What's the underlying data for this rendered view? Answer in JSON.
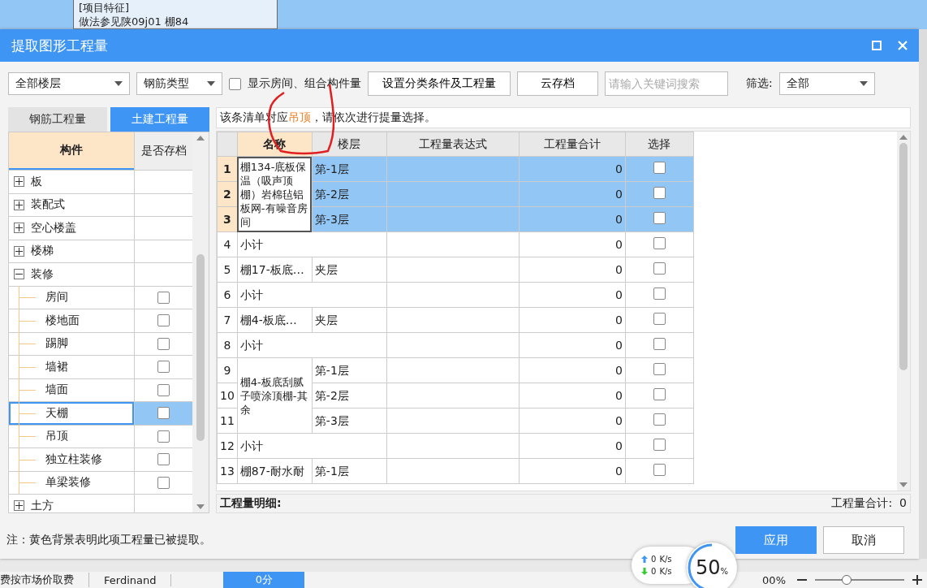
{
  "background_app": {
    "cell_lines": [
      "[项目特征]",
      "做法参见陕09j01 棚84"
    ]
  },
  "dialog": {
    "title": "提取图形工程量"
  },
  "toolbar": {
    "floor_dropdown": "全部楼层",
    "rebar_dropdown": "钢筋类型",
    "show_rooms": {
      "label": "显示房间、组合构件量",
      "checked": false
    },
    "buttons": [
      "设置分类条件及工程量",
      "云存档"
    ],
    "search": {
      "placeholder": "请输入关键词搜索"
    },
    "filter": {
      "label": "筛选:",
      "value": "全部"
    }
  },
  "left_tabs": [
    {
      "label": "钢筋工程量",
      "selected": false
    },
    {
      "label": "土建工程量",
      "selected": true
    }
  ],
  "component_tree": {
    "columns": [
      "构件",
      "是否存档"
    ],
    "items": [
      {
        "label": "板",
        "expanded": false
      },
      {
        "label": "装配式",
        "expanded": false
      },
      {
        "label": "空心楼盖",
        "expanded": false
      },
      {
        "label": "楼梯",
        "expanded": false
      },
      {
        "label": "装修",
        "expanded": true,
        "children": [
          {
            "label": "房间",
            "checked": false,
            "selected": false
          },
          {
            "label": "楼地面",
            "checked": false,
            "selected": false
          },
          {
            "label": "踢脚",
            "checked": false,
            "selected": false
          },
          {
            "label": "墙裙",
            "checked": false,
            "selected": false
          },
          {
            "label": "墙面",
            "checked": false,
            "selected": false
          },
          {
            "label": "天棚",
            "checked": false,
            "selected": true
          },
          {
            "label": "吊顶",
            "checked": false,
            "selected": false
          },
          {
            "label": "独立柱装修",
            "checked": false,
            "selected": false
          },
          {
            "label": "单梁装修",
            "checked": false,
            "selected": false
          }
        ]
      },
      {
        "label": "土方",
        "expanded": false
      }
    ]
  },
  "notice": {
    "before": "该条清单对应",
    "highlight": "吊顶",
    "after": "，请依次进行提量选择。"
  },
  "table": {
    "columns": [
      "名称",
      "楼层",
      "工程量表达式",
      "工程量合计",
      "选择"
    ],
    "groups": [
      {
        "kind": "item",
        "name": "棚134-底板保温（吸声顶棚）岩棉毡铝板网-有噪音房间",
        "focused": true,
        "rows": [
          {
            "no": "1",
            "floor": "第-1层",
            "total": "0",
            "checked": false,
            "selected": true
          },
          {
            "no": "2",
            "floor": "第-2层",
            "total": "0",
            "checked": false,
            "selected": true
          },
          {
            "no": "3",
            "floor": "第-3层",
            "total": "0",
            "checked": false,
            "selected": true
          }
        ]
      },
      {
        "kind": "subtotal",
        "name": "小计",
        "rows": [
          {
            "no": "4",
            "total": "0",
            "checked": false,
            "selected": false
          }
        ]
      },
      {
        "kind": "item",
        "name": "棚17-板底…",
        "focused": false,
        "rows": [
          {
            "no": "5",
            "floor": "夹层",
            "total": "0",
            "checked": false,
            "selected": false
          }
        ]
      },
      {
        "kind": "subtotal",
        "name": "小计",
        "rows": [
          {
            "no": "6",
            "total": "0",
            "checked": false,
            "selected": false
          }
        ]
      },
      {
        "kind": "item",
        "name": "棚4-板底…",
        "focused": false,
        "rows": [
          {
            "no": "7",
            "floor": "夹层",
            "total": "0",
            "checked": false,
            "selected": false
          }
        ]
      },
      {
        "kind": "subtotal",
        "name": "小计",
        "rows": [
          {
            "no": "8",
            "total": "0",
            "checked": false,
            "selected": false
          }
        ]
      },
      {
        "kind": "item",
        "name": "棚4-板底刮腻子喷涂顶棚-其余",
        "focused": false,
        "rows": [
          {
            "no": "9",
            "floor": "第-1层",
            "total": "0",
            "checked": false,
            "selected": false
          },
          {
            "no": "10",
            "floor": "第-2层",
            "total": "0",
            "checked": false,
            "selected": false
          },
          {
            "no": "11",
            "floor": "第-3层",
            "total": "0",
            "checked": false,
            "selected": false
          }
        ]
      },
      {
        "kind": "subtotal",
        "name": "小计",
        "rows": [
          {
            "no": "12",
            "total": "0",
            "checked": false,
            "selected": false
          }
        ]
      },
      {
        "kind": "item",
        "name": "棚87-耐水耐",
        "focused": false,
        "rows": [
          {
            "no": "13",
            "floor": "第-1层",
            "total": "0",
            "checked": false,
            "selected": false
          }
        ]
      }
    ]
  },
  "detail_label": "工程量明细:",
  "total": {
    "label": "工程量合计:",
    "value": "0"
  },
  "note": "注：黄色背景表明此项工程量已被提取。",
  "actions": [
    {
      "label": "应用",
      "kind": "primary"
    },
    {
      "label": "取消",
      "kind": "secondary"
    }
  ],
  "status_bar": {
    "items": [
      "费按市场价取费",
      "Ferdinand"
    ],
    "score_button": "0分",
    "zoom": "00%",
    "zoom_slider": {
      "level": 0.35
    }
  },
  "network_widget": {
    "upload": "0",
    "upload_unit": "K/s",
    "download": "0",
    "download_unit": "K/s"
  },
  "load": {
    "value": "50",
    "unit": "%",
    "level": 0.5
  }
}
